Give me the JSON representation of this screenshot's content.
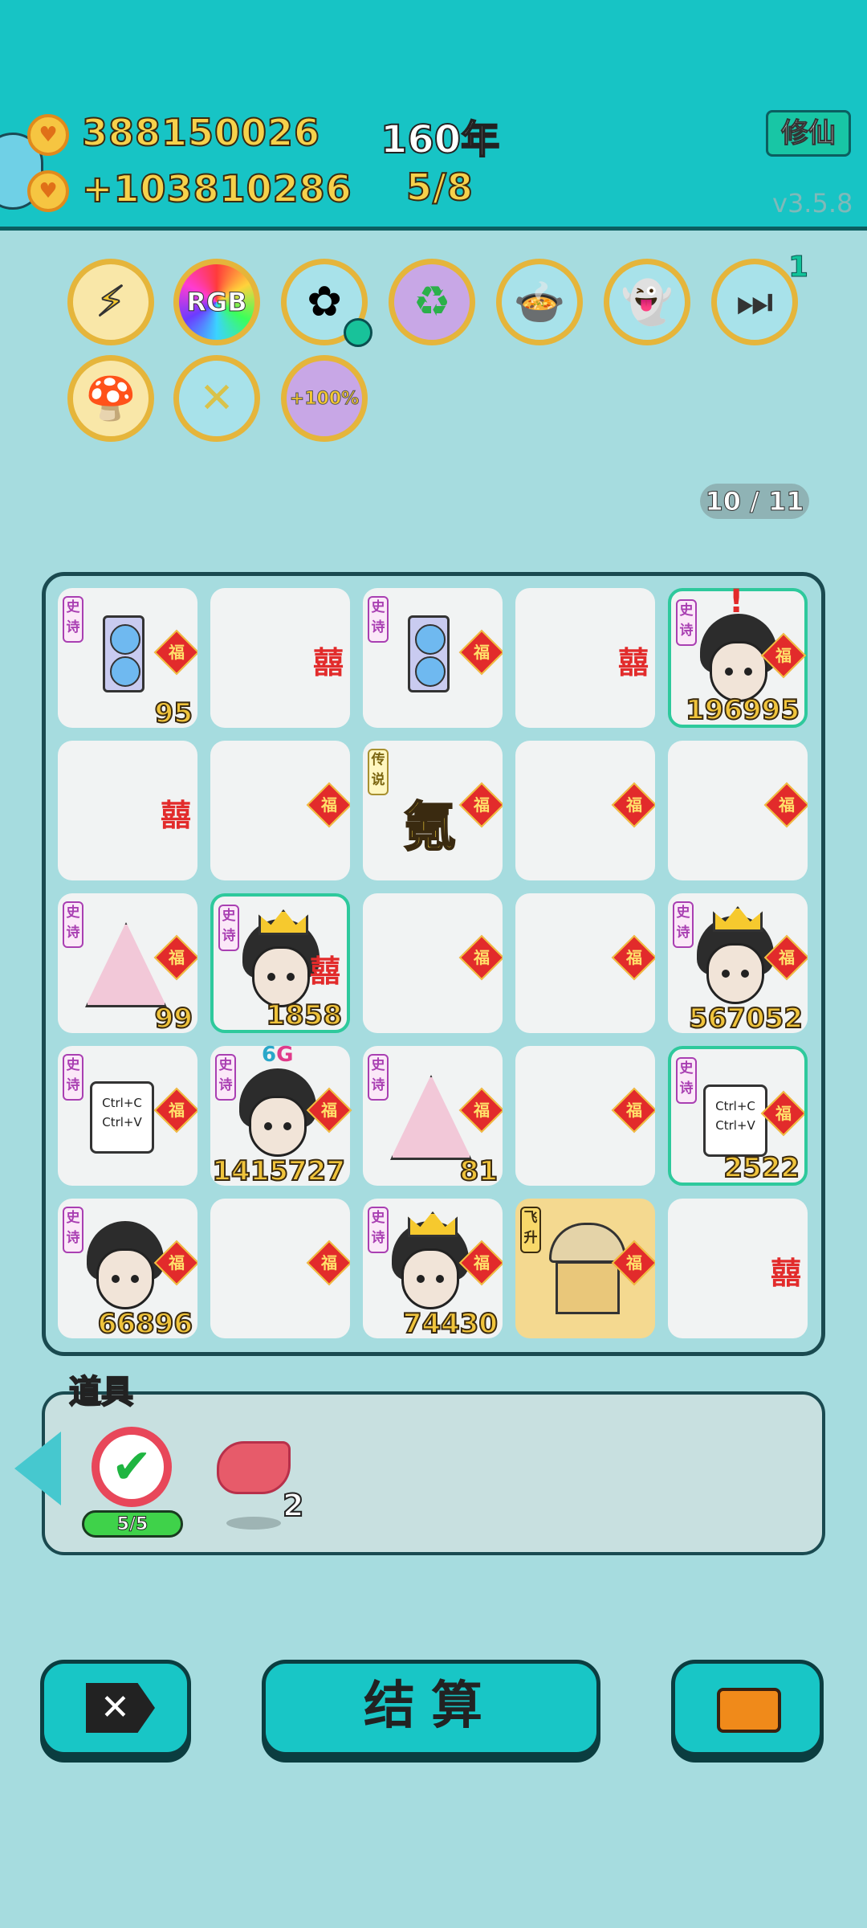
{
  "header": {
    "coins": "388150026",
    "income": "+103810286",
    "years": "160年",
    "round": "5/8",
    "mode_button": "修仙",
    "version": "v3.5.8"
  },
  "orbs": {
    "badge_count": "1",
    "rgb_label": "RGB",
    "bonus_label": "+100%"
  },
  "board": {
    "counter": "10 / 11",
    "tag_epic": "史诗",
    "tag_legend": "传说",
    "tag_fly": "飞升",
    "fu": "福",
    "xi": "囍",
    "element": "氪",
    "network": {
      "num": "6",
      "letter": "G"
    },
    "clipboard": [
      "Ctrl+C",
      "Ctrl+V"
    ],
    "values": [
      "95",
      "196995",
      "99",
      "1858",
      "567052",
      "1415727",
      "81",
      "2522",
      "66896",
      "74430"
    ]
  },
  "items": {
    "title": "道具",
    "uses": "5/5",
    "liver_count": "2"
  },
  "actions": {
    "settle": "结算"
  }
}
